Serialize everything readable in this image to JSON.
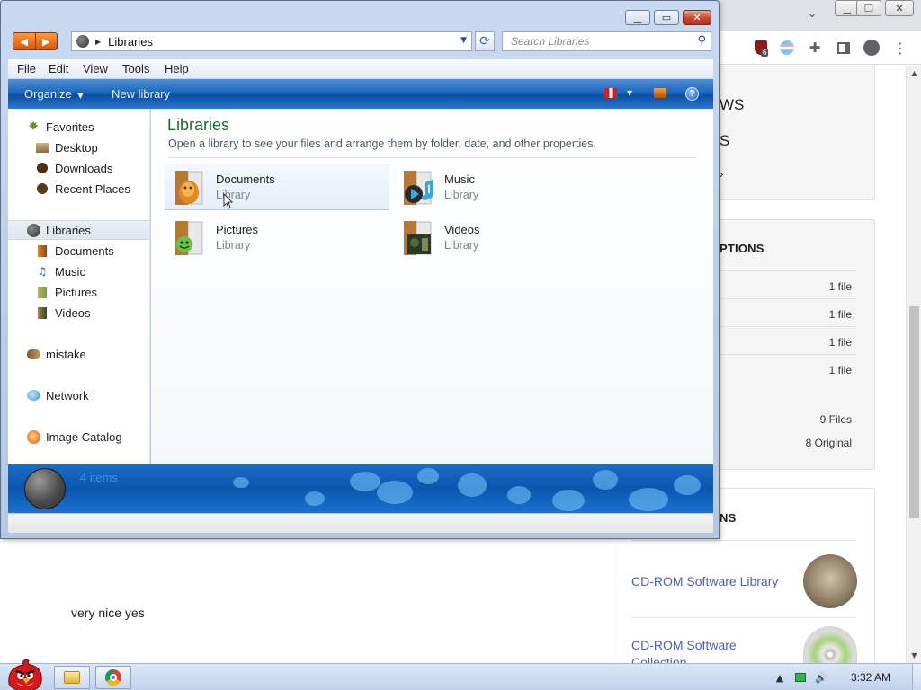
{
  "browser": {
    "window_buttons": [
      "▁",
      "❐",
      "✕"
    ],
    "toolbar_menu": "⋮",
    "ext_badge": "6",
    "cards": {
      "top_big1": "WS",
      "top_big2": "S",
      "top_big3": "›",
      "options_title": "PTIONS",
      "rows": [
        "1 file",
        "1 file",
        "1 file",
        "1 file"
      ],
      "files_total": "9 Files",
      "original_total": "8 Original",
      "related_title": "NS",
      "link1": "CD-ROM Software Library",
      "link2_line1": "CD-ROM Software",
      "link2_line2": "Collection"
    },
    "comment": "very nice yes"
  },
  "explorer": {
    "caption_buttons": {
      "minimize": "▁",
      "restore": "▭",
      "close": "✕"
    },
    "address": {
      "path": "Libraries"
    },
    "search": {
      "placeholder": "Search Libraries"
    },
    "menu": [
      "File",
      "Edit",
      "View",
      "Tools",
      "Help"
    ],
    "commands": {
      "organize": "Organize",
      "new_library": "New library",
      "help": "?"
    },
    "nav": {
      "favorites": "Favorites",
      "desktop": "Desktop",
      "downloads": "Downloads",
      "recent": "Recent Places",
      "libraries": "Libraries",
      "documents": "Documents",
      "music": "Music",
      "pictures": "Pictures",
      "videos": "Videos",
      "mistake": "mistake",
      "network": "Network",
      "image_catalog": "Image Catalog"
    },
    "content": {
      "title": "Libraries",
      "subtitle": "Open a library to see your files and arrange them by folder, date, and other properties.",
      "libraries": [
        {
          "name": "Documents",
          "type": "Library"
        },
        {
          "name": "Music",
          "type": "Library"
        },
        {
          "name": "Pictures",
          "type": "Library"
        },
        {
          "name": "Videos",
          "type": "Library"
        }
      ]
    },
    "details": {
      "count": "4 items"
    }
  },
  "taskbar": {
    "clock": "3:32 AM"
  }
}
